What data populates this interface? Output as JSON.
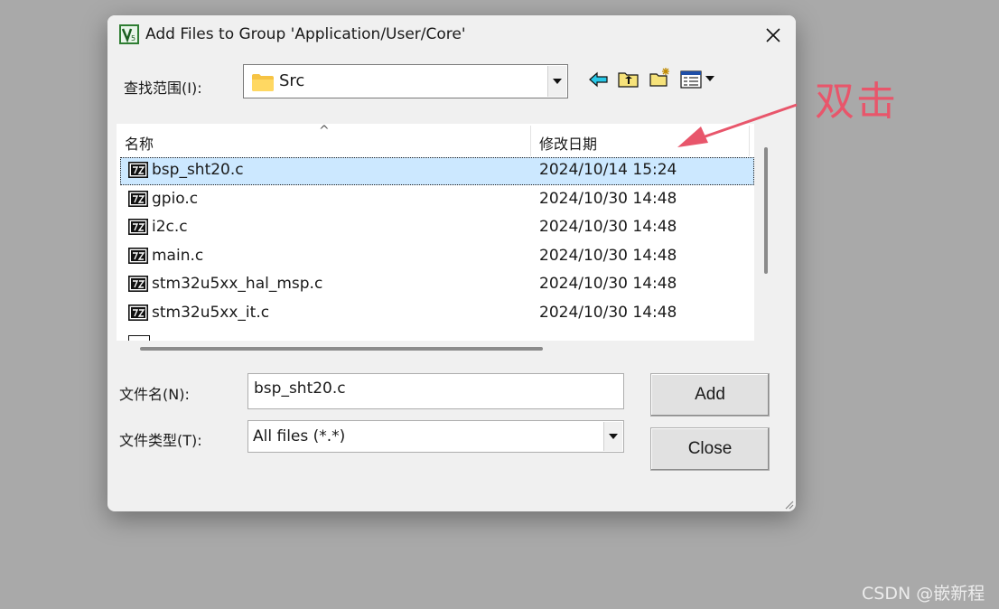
{
  "dialog": {
    "title": "Add Files to Group 'Application/User/Core'",
    "close_icon": "close-icon"
  },
  "lookin": {
    "label": "查找范围(I):",
    "value": "Src",
    "folder_icon": "folder-icon"
  },
  "toolbar": {
    "icons": [
      "back-icon",
      "up-folder-icon",
      "new-folder-icon",
      "view-menu-icon"
    ]
  },
  "list": {
    "columns": [
      "名称",
      "修改日期"
    ],
    "rows": [
      {
        "name": "bsp_sht20.c",
        "date": "2024/10/14 15:24",
        "selected": true
      },
      {
        "name": "gpio.c",
        "date": "2024/10/30 14:48",
        "selected": false
      },
      {
        "name": "i2c.c",
        "date": "2024/10/30 14:48",
        "selected": false
      },
      {
        "name": "main.c",
        "date": "2024/10/30 14:48",
        "selected": false
      },
      {
        "name": "stm32u5xx_hal_msp.c",
        "date": "2024/10/30 14:48",
        "selected": false
      },
      {
        "name": "stm32u5xx_it.c",
        "date": "2024/10/30 14:48",
        "selected": false
      }
    ]
  },
  "filename": {
    "label": "文件名(N):",
    "value": "bsp_sht20.c"
  },
  "filetype": {
    "label": "文件类型(T):",
    "value": "All files (*.*)"
  },
  "buttons": {
    "add": "Add",
    "close": "Close"
  },
  "annotation": {
    "text": "双击",
    "color": "#e8566b"
  },
  "watermark": "CSDN @嵌新程",
  "colors": {
    "selection": "#cce8ff",
    "dialog_bg": "#f0f0f0",
    "backdrop": "#a9a9a9"
  }
}
